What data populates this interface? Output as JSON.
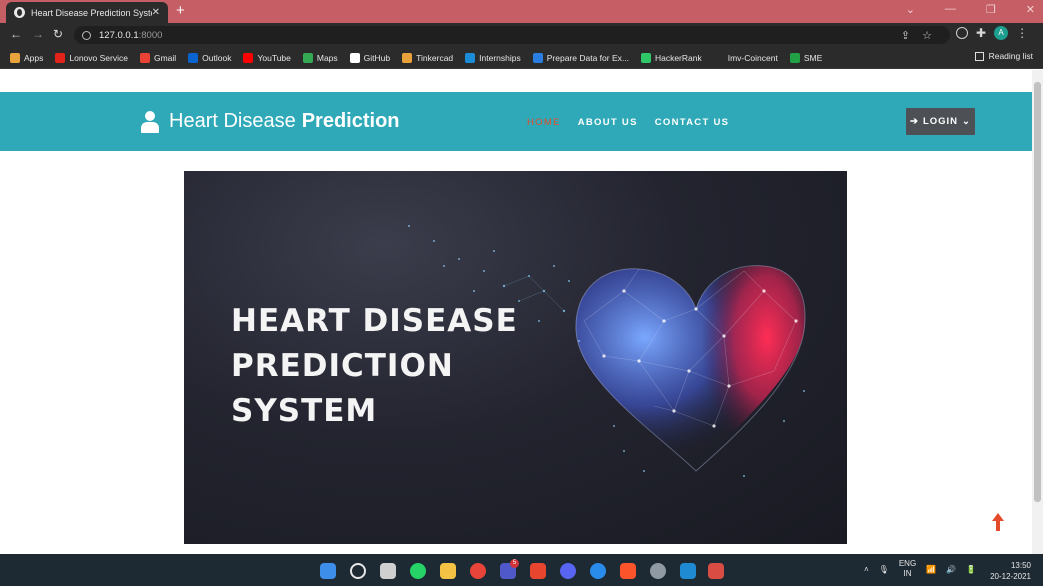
{
  "browser": {
    "tab_title": "Heart Disease Prediction System",
    "tab_close": "✕",
    "new_tab": "+",
    "url_host": "127.0.0.1",
    "url_port": ":8000",
    "bookmarks": [
      {
        "label": "Apps",
        "color": "#e8a33d"
      },
      {
        "label": "Lonovo Service",
        "color": "#e2231a"
      },
      {
        "label": "Gmail",
        "color": "#ea4335"
      },
      {
        "label": "Outlook",
        "color": "#0a64d0"
      },
      {
        "label": "YouTube",
        "color": "#ff0000"
      },
      {
        "label": "Maps",
        "color": "#34a853"
      },
      {
        "label": "GitHub",
        "color": "#ffffff"
      },
      {
        "label": "Tinkercad",
        "color": "#e9a23b"
      },
      {
        "label": "Internships",
        "color": "#1a8cd8"
      },
      {
        "label": "Prepare Data for Ex...",
        "color": "#2a7de1"
      },
      {
        "label": "HackerRank",
        "color": "#2ec866"
      },
      {
        "label": "Imv-Coincent",
        "color": "#2b2b2b"
      },
      {
        "label": "SME",
        "color": "#22a045"
      }
    ],
    "reading_list": "Reading list",
    "profile_initial": "A"
  },
  "site": {
    "brand_light": "Heart Disease",
    "brand_bold": "Prediction",
    "nav": [
      {
        "label": "HOME",
        "active": true
      },
      {
        "label": "ABOUT US",
        "active": false
      },
      {
        "label": "CONTACT US",
        "active": false
      }
    ],
    "login_label": "LOGIN",
    "banner_lines": [
      "HEART DISEASE",
      "PREDICTION",
      "SYSTEM"
    ],
    "accent_color": "#2fa9b8",
    "active_color": "#e44b2c"
  },
  "taskbar": {
    "lang_top": "ENG",
    "lang_bottom": "IN",
    "time": "13:50",
    "date": "20-12-2021",
    "badge": "5"
  }
}
